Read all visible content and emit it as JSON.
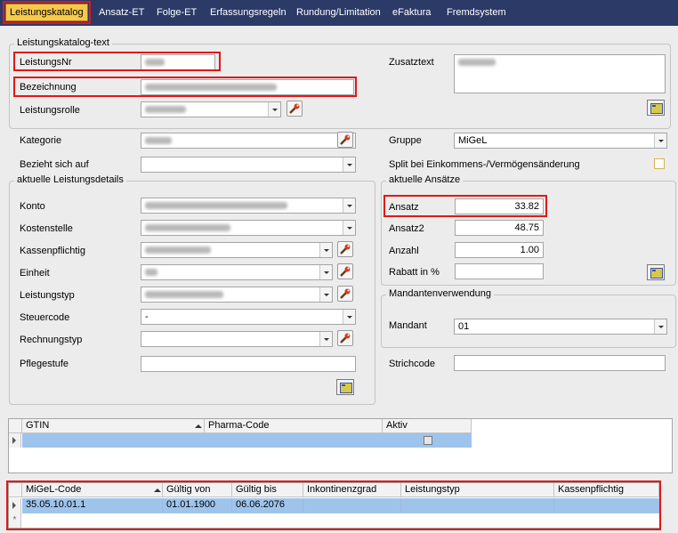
{
  "tabs": [
    "Leistungskatalog",
    "Ansatz-ET",
    "Folge-ET",
    "Erfassungsregeln",
    "Rundung/Limitation",
    "eFaktura",
    "Fremdsystem"
  ],
  "catalog_group": {
    "title": "Leistungskatalog-text",
    "leistungsnr_label": "LeistungsNr",
    "bezeichnung_label": "Bezeichnung",
    "leistungsrolle_label": "Leistungsrolle",
    "zusatztext_label": "Zusatztext"
  },
  "kategorie": {
    "label": "Kategorie",
    "value": ""
  },
  "bezieht_label": "Bezieht sich auf",
  "gruppe": {
    "label": "Gruppe",
    "value": "MiGeL"
  },
  "split_label": "Split bei Einkommens-/Vermögensänderung",
  "details": {
    "title": "aktuelle Leistungsdetails",
    "konto_label": "Konto",
    "kostenstelle_label": "Kostenstelle",
    "kassenpflichtig_label": "Kassenpflichtig",
    "einheit_label": "Einheit",
    "leistungstyp_label": "Leistungstyp",
    "steuercode_label": "Steuercode",
    "steuercode_value": "-",
    "rechnungstyp_label": "Rechnungstyp",
    "pflegestufe_label": "Pflegestufe"
  },
  "ansaetze": {
    "title": "aktuelle Ansätze",
    "ansatz_label": "Ansatz",
    "ansatz_value": "33.82",
    "ansatz2_label": "Ansatz2",
    "ansatz2_value": "48.75",
    "anzahl_label": "Anzahl",
    "anzahl_value": "1.00",
    "rabatt_label": "Rabatt in %"
  },
  "mandanten": {
    "title": "Mandantenverwendung",
    "mandant_label": "Mandant",
    "mandant_value": "01"
  },
  "strichcode_label": "Strichcode",
  "gtin_grid": {
    "columns": [
      "GTIN",
      "Pharma-Code",
      "Aktiv"
    ]
  },
  "migel_grid": {
    "columns": [
      "MiGeL-Code",
      "Gültig von",
      "Gültig bis",
      "Inkontinenzgrad",
      "Leistungstyp",
      "Kassenpflichtig"
    ],
    "rows": [
      [
        "35.05.10.01.1",
        "01.01.1900",
        "06.06.2076",
        "",
        "",
        ""
      ]
    ],
    "new_row_marker": "*"
  },
  "colors": {
    "highlight": "#e01818",
    "tabbar": "#2b3a67",
    "active_tab": "#f6c94a",
    "selected_row": "#9fc4ec"
  }
}
